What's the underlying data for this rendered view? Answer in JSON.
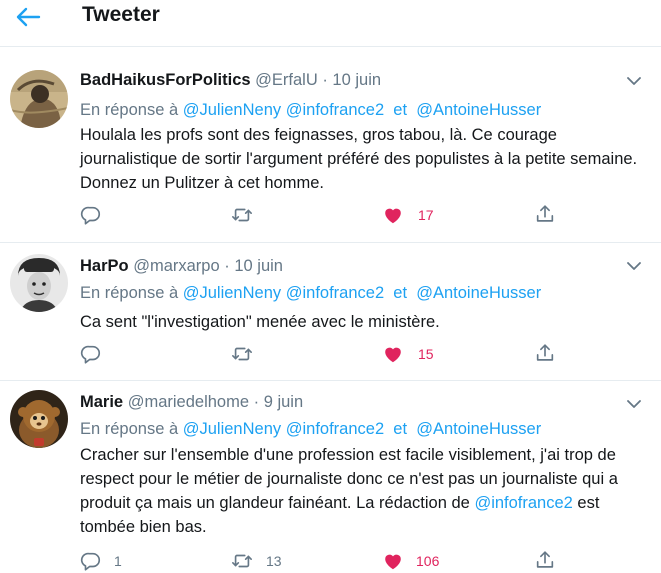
{
  "header": {
    "title": "Tweeter"
  },
  "tweets": [
    {
      "name": "BadHaikusForPolitics",
      "handle": "@ErfalU",
      "dot": "·",
      "date": "10 juin",
      "reply_prefix": "En réponse à",
      "mentions": [
        "@JulienNeny",
        "@infofrance2",
        "@AntoineHusser"
      ],
      "and": "et",
      "text": "Houlala les profs sont des feignasses, gros tabou, là. Ce courage journalistique de sortir l'argument préféré des populistes à la petite semaine. Donnez un Pulitzer à cet homme.",
      "likes": "17"
    },
    {
      "name": "HarPo",
      "handle": "@marxarpo",
      "dot": "·",
      "date": "10 juin",
      "reply_prefix": "En réponse à",
      "mentions": [
        "@JulienNeny",
        "@infofrance2",
        "@AntoineHusser"
      ],
      "and": "et",
      "text": "Ca sent \"l'investigation\" menée avec le ministère.",
      "likes": "15"
    },
    {
      "name": "Marie",
      "handle": "@mariedelhome",
      "dot": "·",
      "date": "9 juin",
      "reply_prefix": "En réponse à",
      "mentions": [
        "@JulienNeny",
        "@infofrance2",
        "@AntoineHusser"
      ],
      "and": "et",
      "text": "Cracher sur l'ensemble d'une profession est facile visiblement, j'ai trop de respect pour le métier de journaliste donc ce n'est pas un journaliste qui a produit ça mais un glandeur fainéant. La rédaction de",
      "text_link": "@infofrance2",
      "text_end": " est tombée bien bas.",
      "replies": "1",
      "retweets": "13",
      "likes": "106"
    }
  ],
  "colors": {
    "accent": "#1da1f2",
    "like": "#e0245e",
    "secondary": "#657786",
    "text": "#14171a",
    "divider": "#e6ecf0"
  },
  "icons": [
    "back-arrow-icon",
    "chevron-down-icon",
    "reply-icon",
    "retweet-icon",
    "heart-icon",
    "share-icon"
  ]
}
